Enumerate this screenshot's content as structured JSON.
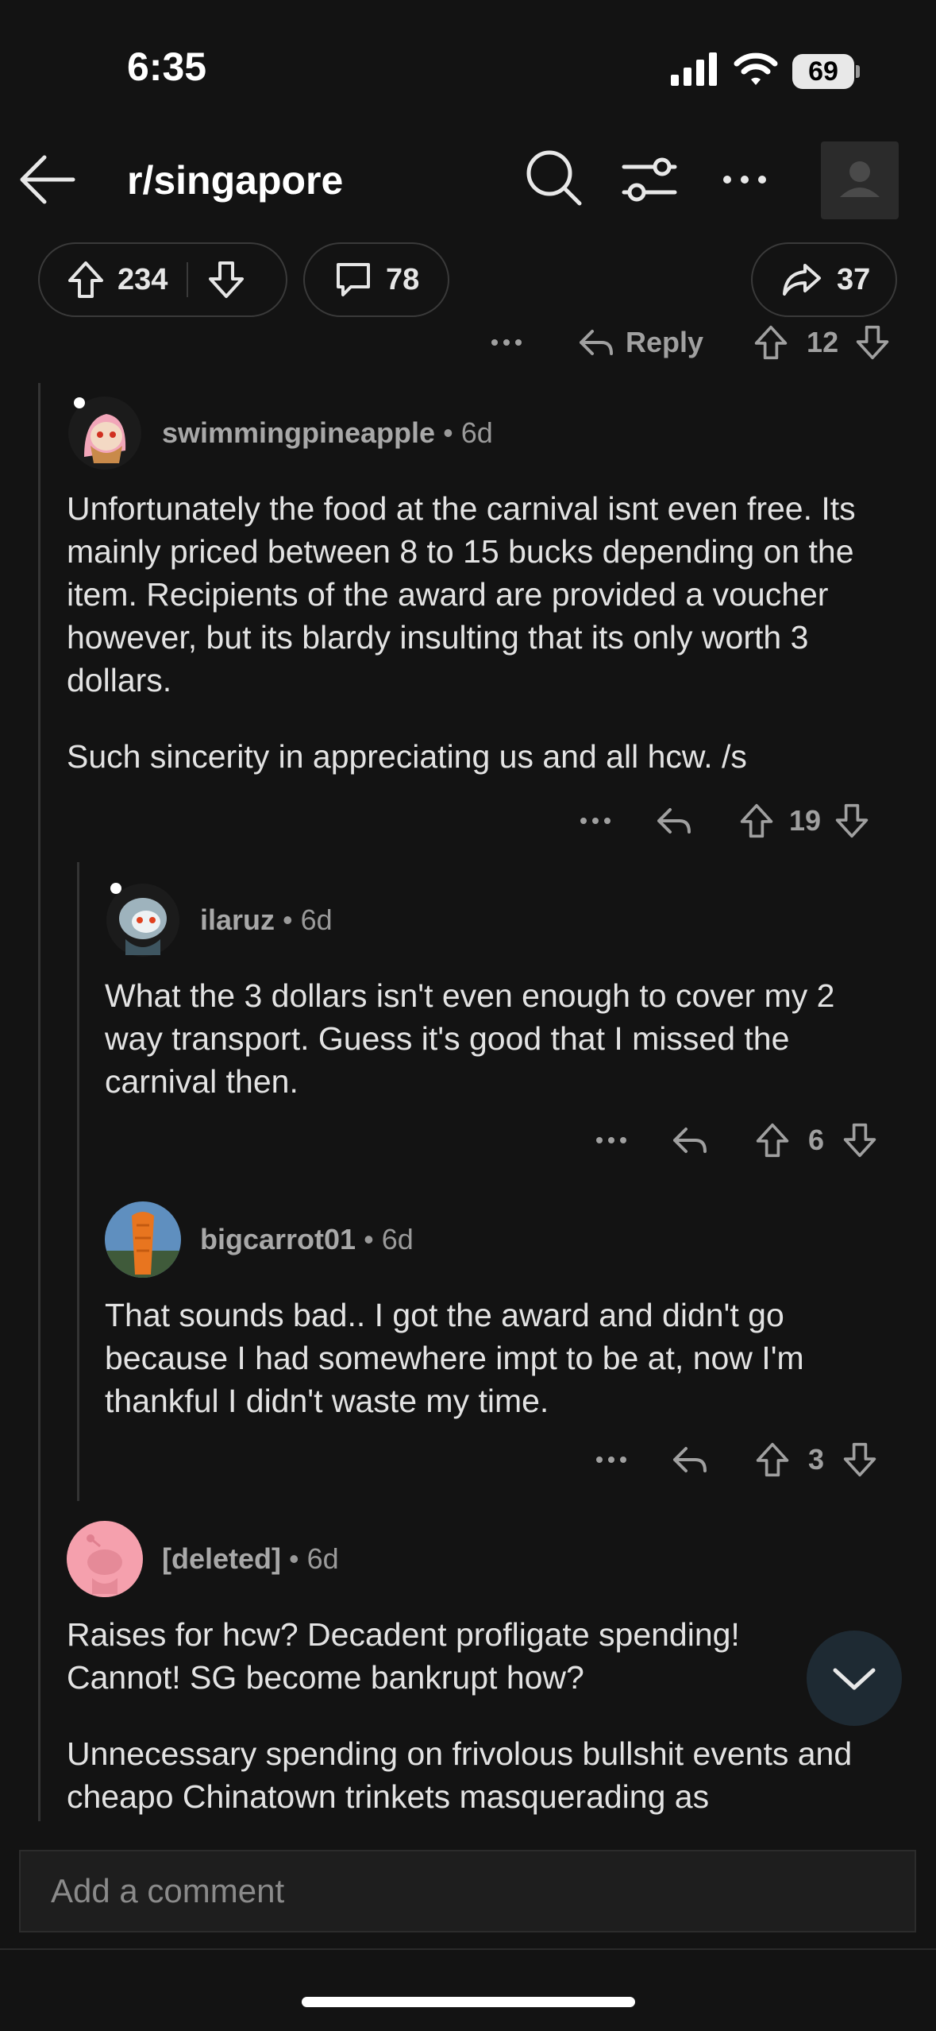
{
  "status": {
    "time": "6:35",
    "battery": "69"
  },
  "header": {
    "title": "r/singapore"
  },
  "post_actions": {
    "upvotes": "234",
    "comments": "78",
    "shares": "37"
  },
  "parent_actions": {
    "reply_label": "Reply",
    "score": "12"
  },
  "comments": [
    {
      "user": "swimmingpineapple",
      "age": "6d",
      "paragraphs": [
        "Unfortunately the food at the carnival isnt even free. Its mainly priced between 8 to 15 bucks depending on the item. Recipients of the award are provided a voucher however, but its blardy insulting that its only worth 3 dollars.",
        "Such sincerity in appreciating us and all hcw.  /s"
      ],
      "score": "19"
    },
    {
      "user": "ilaruz",
      "age": "6d",
      "paragraphs": [
        "What the 3 dollars isn't even enough to cover my 2 way transport. Guess it's good that I missed the carnival then."
      ],
      "score": "6"
    },
    {
      "user": "bigcarrot01",
      "age": "6d",
      "paragraphs": [
        "That sounds bad.. I got the award and didn't go because I had somewhere impt to be at, now I'm thankful I didn't waste my time."
      ],
      "score": "3"
    },
    {
      "user": "[deleted]",
      "age": "6d",
      "paragraphs": [
        "Raises for hcw? Decadent profligate spending! Cannot! SG become bankrupt how?",
        "Unnecessary spending on frivolous bullshit events and cheapo Chinatown trinkets masquerading as"
      ]
    }
  ],
  "comment_input": {
    "placeholder": "Add a comment"
  },
  "colors": {
    "background": "#131313",
    "pill_border": "#3a3a3a",
    "deleted_avatar": "#f5a0ad",
    "scroll_button": "#1e2a33"
  }
}
